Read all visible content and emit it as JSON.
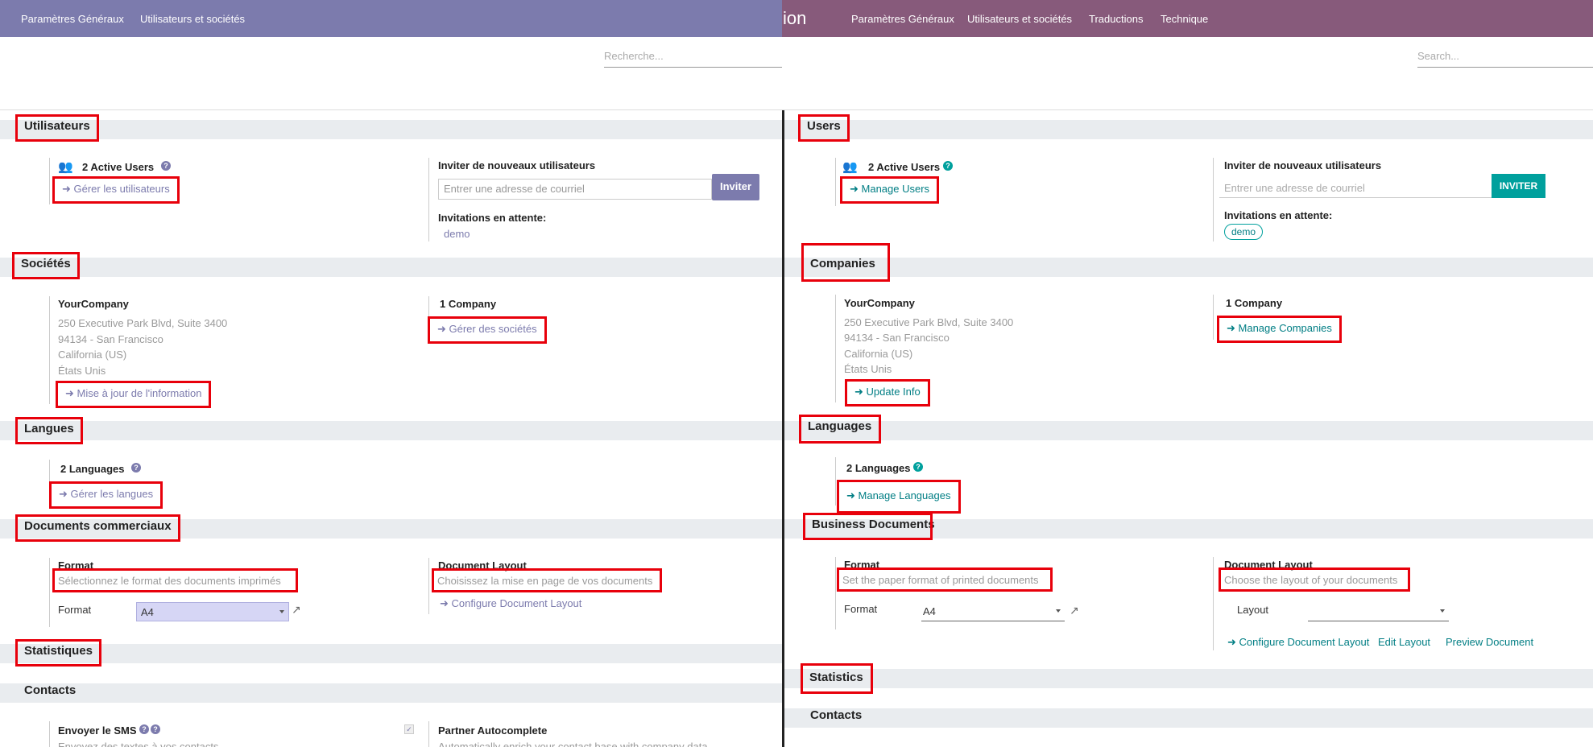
{
  "left": {
    "nav": {
      "items": [
        "Paramètres Généraux",
        "Utilisateurs et sociétés"
      ]
    },
    "search": {
      "placeholder": "Recherche..."
    },
    "users": {
      "title": "Utilisateurs",
      "active_users": "2 Active Users",
      "manage": "Gérer les utilisateurs",
      "invite_title": "Inviter de nouveaux utilisateurs",
      "invite_placeholder": "Entrer une adresse de courriel",
      "invite_button": "Inviter",
      "pending_title": "Invitations en attente:",
      "pending_user": "demo"
    },
    "companies": {
      "title": "Sociétés",
      "name": "YourCompany",
      "address": [
        "250 Executive Park Blvd, Suite 3400",
        "94134 - San Francisco",
        "California (US)",
        "États Unis"
      ],
      "update": "Mise à jour de l'information",
      "count": "1 Company",
      "manage": "Gérer des sociétés"
    },
    "languages": {
      "title": "Langues",
      "count": "2 Languages",
      "manage": "Gérer les langues"
    },
    "documents": {
      "title": "Documents commerciaux",
      "format_title": "Format",
      "format_desc": "Sélectionnez le format des documents imprimés",
      "format_label": "Format",
      "format_value": "A4",
      "layout_title": "Document Layout",
      "layout_desc": "Choisissez la mise en page de vos documents",
      "configure": "Configure Document Layout"
    },
    "statistics": {
      "title": "Statistiques"
    },
    "contacts": {
      "title": "Contacts",
      "sms": "Envoyer le SMS",
      "sms_desc": "Envoyez des textes à vos contacts",
      "autocomplete": "Partner Autocomplete",
      "autocomplete_desc": "Automatically enrich your contact base with company data"
    }
  },
  "right": {
    "nav": {
      "brand": "ion",
      "items": [
        "Paramètres Généraux",
        "Utilisateurs et sociétés",
        "Traductions",
        "Technique"
      ]
    },
    "search": {
      "placeholder": "Search..."
    },
    "users": {
      "title": "Users",
      "active_users": "2 Active Users",
      "manage": "Manage Users",
      "invite_title": "Inviter de nouveaux utilisateurs",
      "invite_placeholder": "Entrer une adresse de courriel",
      "invite_button": "INVITER",
      "pending_title": "Invitations en attente:",
      "pending_user": "demo"
    },
    "companies": {
      "title": "Companies",
      "name": "YourCompany",
      "address": [
        "250 Executive Park Blvd, Suite 3400",
        "94134 - San Francisco",
        "California (US)",
        "États Unis"
      ],
      "update": "Update Info",
      "count": "1 Company",
      "manage": "Manage Companies"
    },
    "languages": {
      "title": "Languages",
      "count": "2 Languages",
      "manage": "Manage Languages"
    },
    "documents": {
      "title": "Business Documents",
      "format_title": "Format",
      "format_desc": "Set the paper format of printed documents",
      "format_label": "Format",
      "format_value": "A4",
      "layout_title": "Document Layout",
      "layout_desc": "Choose the layout of your documents",
      "layout_label": "Layout",
      "configure": "Configure Document Layout",
      "edit": "Edit Layout",
      "preview": "Preview Document"
    },
    "statistics": {
      "title": "Statistics"
    },
    "contacts": {
      "title": "Contacts"
    }
  },
  "icons": {
    "users": "users-icon",
    "help": "question-circle-icon",
    "arrow": "arrow-right-icon",
    "external": "external-link-icon"
  },
  "colors": {
    "left_nav": "#7c7bad",
    "right_nav": "#875a7b",
    "right_accent": "#00a09d",
    "highlight_box": "#e8000b"
  }
}
